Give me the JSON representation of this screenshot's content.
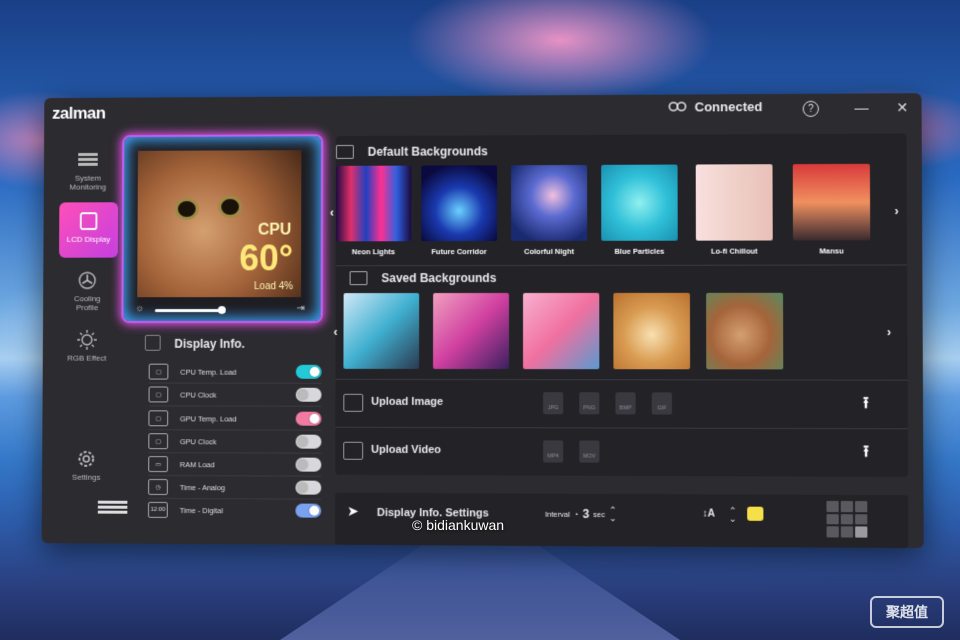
{
  "app": {
    "logo": "zalman",
    "status": "Connected",
    "help": "?",
    "minimize": "—",
    "close": "✕"
  },
  "sidebar": {
    "items": [
      {
        "label": "System\nMonitoring",
        "icon": "monitoring-icon"
      },
      {
        "label": "LCD Display",
        "icon": "lcd-icon",
        "active": true
      },
      {
        "label": "Cooling\nProfile",
        "icon": "fan-icon"
      },
      {
        "label": "RGB Effect",
        "icon": "sun-icon"
      },
      {
        "label": "Settings",
        "icon": "gear-icon"
      }
    ]
  },
  "preview": {
    "overlay_label": "CPU",
    "overlay_value": "60°",
    "overlay_load": "Load  4%",
    "brightness_level": 0.45
  },
  "display_info": {
    "title": "Display Info.",
    "rows": [
      {
        "label": "CPU Temp.    Load",
        "icon": "cpu-temp-icon",
        "state": "on",
        "color": "#22c9d6"
      },
      {
        "label": "CPU Clock",
        "icon": "cpu-clock-icon",
        "state": "off"
      },
      {
        "label": "GPU Temp.    Load",
        "icon": "gpu-temp-icon",
        "state": "on",
        "color": "#f07aa0"
      },
      {
        "label": "GPU Clock",
        "icon": "gpu-clock-icon",
        "state": "off"
      },
      {
        "label": "RAM Load",
        "icon": "ram-icon",
        "state": "off"
      },
      {
        "label": "Time - Analog",
        "icon": "clock-icon",
        "state": "off"
      },
      {
        "label": "Time - Digital",
        "icon": "digital-clock-icon",
        "icon_text": "12:00",
        "state": "on",
        "color": "#7aa0f0"
      }
    ]
  },
  "default_backgrounds": {
    "title": "Default Backgrounds",
    "items": [
      "Neon Lights",
      "Future Corridor",
      "Colorful Night",
      "Blue Particles",
      "Lo-fi Chillout",
      "Mansu"
    ]
  },
  "saved_backgrounds": {
    "title": "Saved Backgrounds"
  },
  "upload": {
    "image_label": "Upload Image",
    "image_formats": [
      "JPG",
      "PNG",
      "BMP",
      "GIF"
    ],
    "video_label": "Upload Video",
    "video_formats": [
      "MP4",
      "MOV"
    ]
  },
  "settings_bar": {
    "label": "Display Info. Settings",
    "interval_label": "Interval",
    "interval_value": "3",
    "interval_unit": "sec",
    "font_icon_text": "↕A",
    "color": "#f5e04a"
  },
  "watermark": "© bidiankuwan",
  "corner_mark": "聚超值"
}
